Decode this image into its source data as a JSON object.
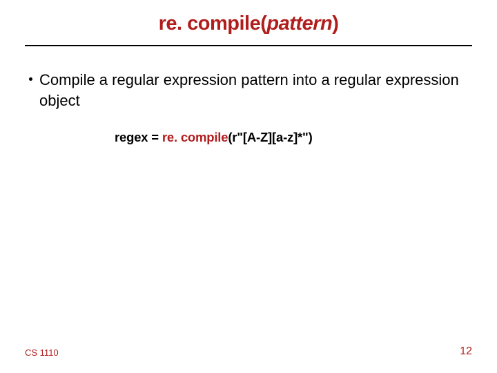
{
  "title": {
    "fn": "re. compile(",
    "arg": "pattern",
    "close": ")"
  },
  "bullet": "Compile a regular expression pattern into a regular expression object",
  "code": {
    "lhs": "regex = ",
    "fn": "re. compile",
    "args": "(r\"[A-Z][a-z]*\")"
  },
  "footer": {
    "course": "CS 1110",
    "page": "12"
  }
}
